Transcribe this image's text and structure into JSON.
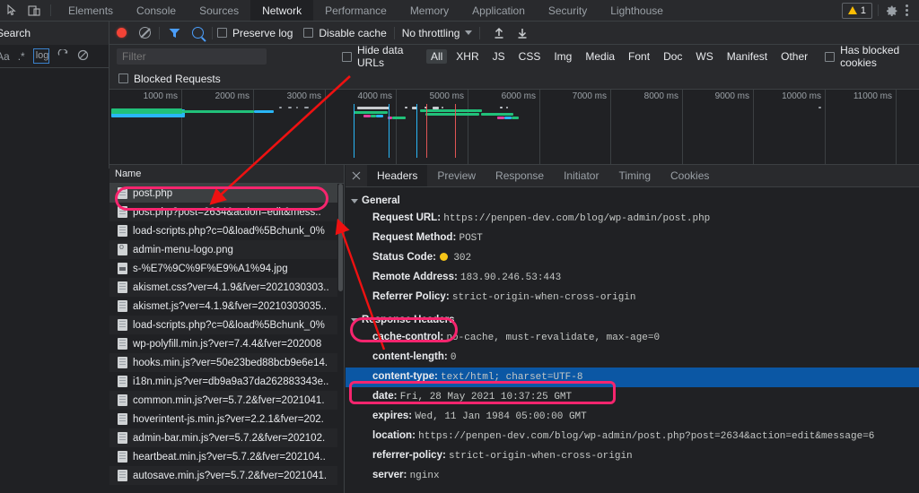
{
  "window": {
    "devtools_tabs": [
      "Elements",
      "Console",
      "Sources",
      "Network",
      "Performance",
      "Memory",
      "Application",
      "Security",
      "Lighthouse"
    ],
    "active_tab": "Network",
    "warning_count": "1",
    "inspect_icon": "inspect-element-icon",
    "device_icon": "device-toolbar-icon",
    "settings_icon": "gear-icon",
    "more_icon": "kebab-menu-icon"
  },
  "search_pane": {
    "title": "Search",
    "close_icon": "close-icon",
    "match_case_label": "Aa",
    "regex_label": ".*",
    "logical_label": "log",
    "refresh_icon": "refresh-icon",
    "clear_icon": "clear-icon"
  },
  "network_toolbar": {
    "record_icon": "record-icon",
    "clear_icon": "clear-network-icon",
    "filter_icon": "filter-funnel-icon",
    "search_icon": "search-icon",
    "preserve_log_label": "Preserve log",
    "disable_cache_label": "Disable cache",
    "throttling_value": "No throttling",
    "throttling_caret": "chevron-down-icon",
    "import_icon": "import-har-icon",
    "export_icon": "export-har-icon"
  },
  "filter_bar": {
    "placeholder": "Filter",
    "value": "",
    "hide_data_urls_label": "Hide data URLs",
    "types": [
      "All",
      "XHR",
      "JS",
      "CSS",
      "Img",
      "Media",
      "Font",
      "Doc",
      "WS",
      "Manifest",
      "Other"
    ],
    "active_type": "All",
    "has_blocked_cookies_label": "Has blocked cookies",
    "blocked_requests_label": "Blocked Requests"
  },
  "overview": {
    "ticks": [
      "1000 ms",
      "2000 ms",
      "3000 ms",
      "4000 ms",
      "5000 ms",
      "6000 ms",
      "7000 ms",
      "8000 ms",
      "9000 ms",
      "10000 ms",
      "11000 ms"
    ]
  },
  "request_list": {
    "column_header": "Name",
    "rows": [
      {
        "name": "post.php",
        "icon": "document-file-icon",
        "selected": true
      },
      {
        "name": "post.php?post=2634&action=edit&mess..",
        "icon": "document-file-icon",
        "selected": false
      },
      {
        "name": "load-scripts.php?c=0&load%5Bchunk_0%",
        "icon": "document-file-icon",
        "selected": false
      },
      {
        "name": "admin-menu-logo.png",
        "icon": "png-image-icon",
        "selected": false
      },
      {
        "name": "s-%E7%9C%9F%E9%A1%94.jpg",
        "icon": "jpg-image-icon",
        "selected": false
      },
      {
        "name": "akismet.css?ver=4.1.9&fver=2021030303..",
        "icon": "document-file-icon",
        "selected": false
      },
      {
        "name": "akismet.js?ver=4.1.9&fver=20210303035..",
        "icon": "document-file-icon",
        "selected": false
      },
      {
        "name": "load-scripts.php?c=0&load%5Bchunk_0%",
        "icon": "document-file-icon",
        "selected": false
      },
      {
        "name": "wp-polyfill.min.js?ver=7.4.4&fver=202008",
        "icon": "document-file-icon",
        "selected": false
      },
      {
        "name": "hooks.min.js?ver=50e23bed88bcb9e6e14.",
        "icon": "document-file-icon",
        "selected": false
      },
      {
        "name": "i18n.min.js?ver=db9a9a37da262883343e..",
        "icon": "document-file-icon",
        "selected": false
      },
      {
        "name": "common.min.js?ver=5.7.2&fver=2021041.",
        "icon": "document-file-icon",
        "selected": false
      },
      {
        "name": "hoverintent-js.min.js?ver=2.2.1&fver=202.",
        "icon": "document-file-icon",
        "selected": false
      },
      {
        "name": "admin-bar.min.js?ver=5.7.2&fver=202102.",
        "icon": "document-file-icon",
        "selected": false
      },
      {
        "name": "heartbeat.min.js?ver=5.7.2&fver=202104..",
        "icon": "document-file-icon",
        "selected": false
      },
      {
        "name": "autosave.min.js?ver=5.7.2&fver=2021041.",
        "icon": "document-file-icon",
        "selected": false
      }
    ]
  },
  "details": {
    "close_icon": "close-icon",
    "tabs": [
      "Headers",
      "Preview",
      "Response",
      "Initiator",
      "Timing",
      "Cookies"
    ],
    "active_tab": "Headers",
    "general": {
      "title": "General",
      "rows": [
        {
          "key": "Request URL:",
          "value": "https://penpen-dev.com/blog/wp-admin/post.php"
        },
        {
          "key": "Request Method:",
          "value": "POST"
        },
        {
          "key": "Status Code:",
          "value": "302",
          "status_dot": true
        },
        {
          "key": "Remote Address:",
          "value": "183.90.246.53:443"
        },
        {
          "key": "Referrer Policy:",
          "value": "strict-origin-when-cross-origin"
        }
      ]
    },
    "response_headers": {
      "title": "Response Headers",
      "rows": [
        {
          "key": "cache-control:",
          "value": "no-cache, must-revalidate, max-age=0",
          "highlighted": false
        },
        {
          "key": "content-length:",
          "value": "0",
          "highlighted": false
        },
        {
          "key": "content-type:",
          "value": "text/html; charset=UTF-8",
          "highlighted": true
        },
        {
          "key": "date:",
          "value": "Fri, 28 May 2021 10:37:25 GMT",
          "highlighted": false
        },
        {
          "key": "expires:",
          "value": "Wed, 11 Jan 1984 05:00:00 GMT",
          "highlighted": false
        },
        {
          "key": "location:",
          "value": "https://penpen-dev.com/blog/wp-admin/post.php?post=2634&action=edit&message=6",
          "highlighted": false
        },
        {
          "key": "referrer-policy:",
          "value": "strict-origin-when-cross-origin",
          "highlighted": false
        },
        {
          "key": "server:",
          "value": "nginx",
          "highlighted": false
        }
      ]
    }
  },
  "annotations": {
    "highlight_color": "#f6256e",
    "arrow_color": "#ee1111",
    "boxes": [
      "post-php-row-highlight",
      "response-headers-highlight",
      "content-type-row-highlight"
    ],
    "arrows": [
      "arrow-to-post-php-row",
      "arrow-to-response-headers"
    ]
  }
}
